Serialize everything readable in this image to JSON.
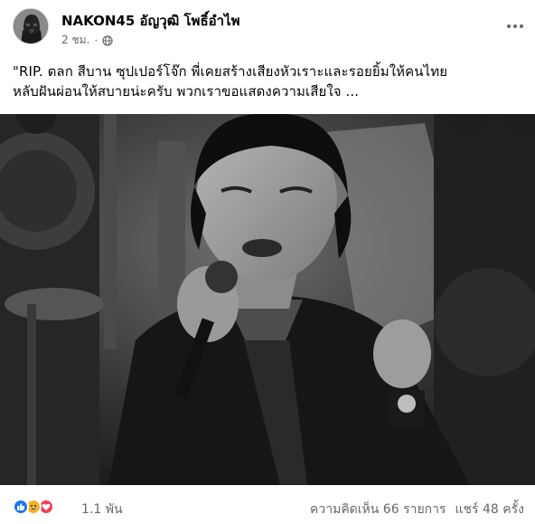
{
  "post": {
    "author": "NAKON45 อัญวุฒิ โพธิ์อำไพ",
    "time": "2 ชม.",
    "separator": "·",
    "privacy_icon": "globe-icon",
    "more_icon": "more-options-icon",
    "caption_line1": "\"RIP. ตลก สีบาน ซุปเปอร์โจ๊ก พี่เคยสร้างเสียงหัวเราะและรอยยิ้มให้คนไทย",
    "caption_line2": "หลับฝันผ่อนให้สบายน่ะครับ พวกเราขอแสดงความเสียใจ ..."
  },
  "footer": {
    "reaction_icons": [
      "like-reaction-icon",
      "sad-reaction-icon",
      "love-reaction-icon"
    ],
    "reaction_count": "1.1 พัน",
    "comments": "ความคิดเห็น 66 รายการ",
    "shares": "แชร์ 48 ครั้ง"
  },
  "colors": {
    "text_primary": "#050505",
    "text_secondary": "#65676b",
    "like_blue": "#1877f2",
    "love_red": "#f33e58",
    "sad_yellow": "#f7b125"
  }
}
